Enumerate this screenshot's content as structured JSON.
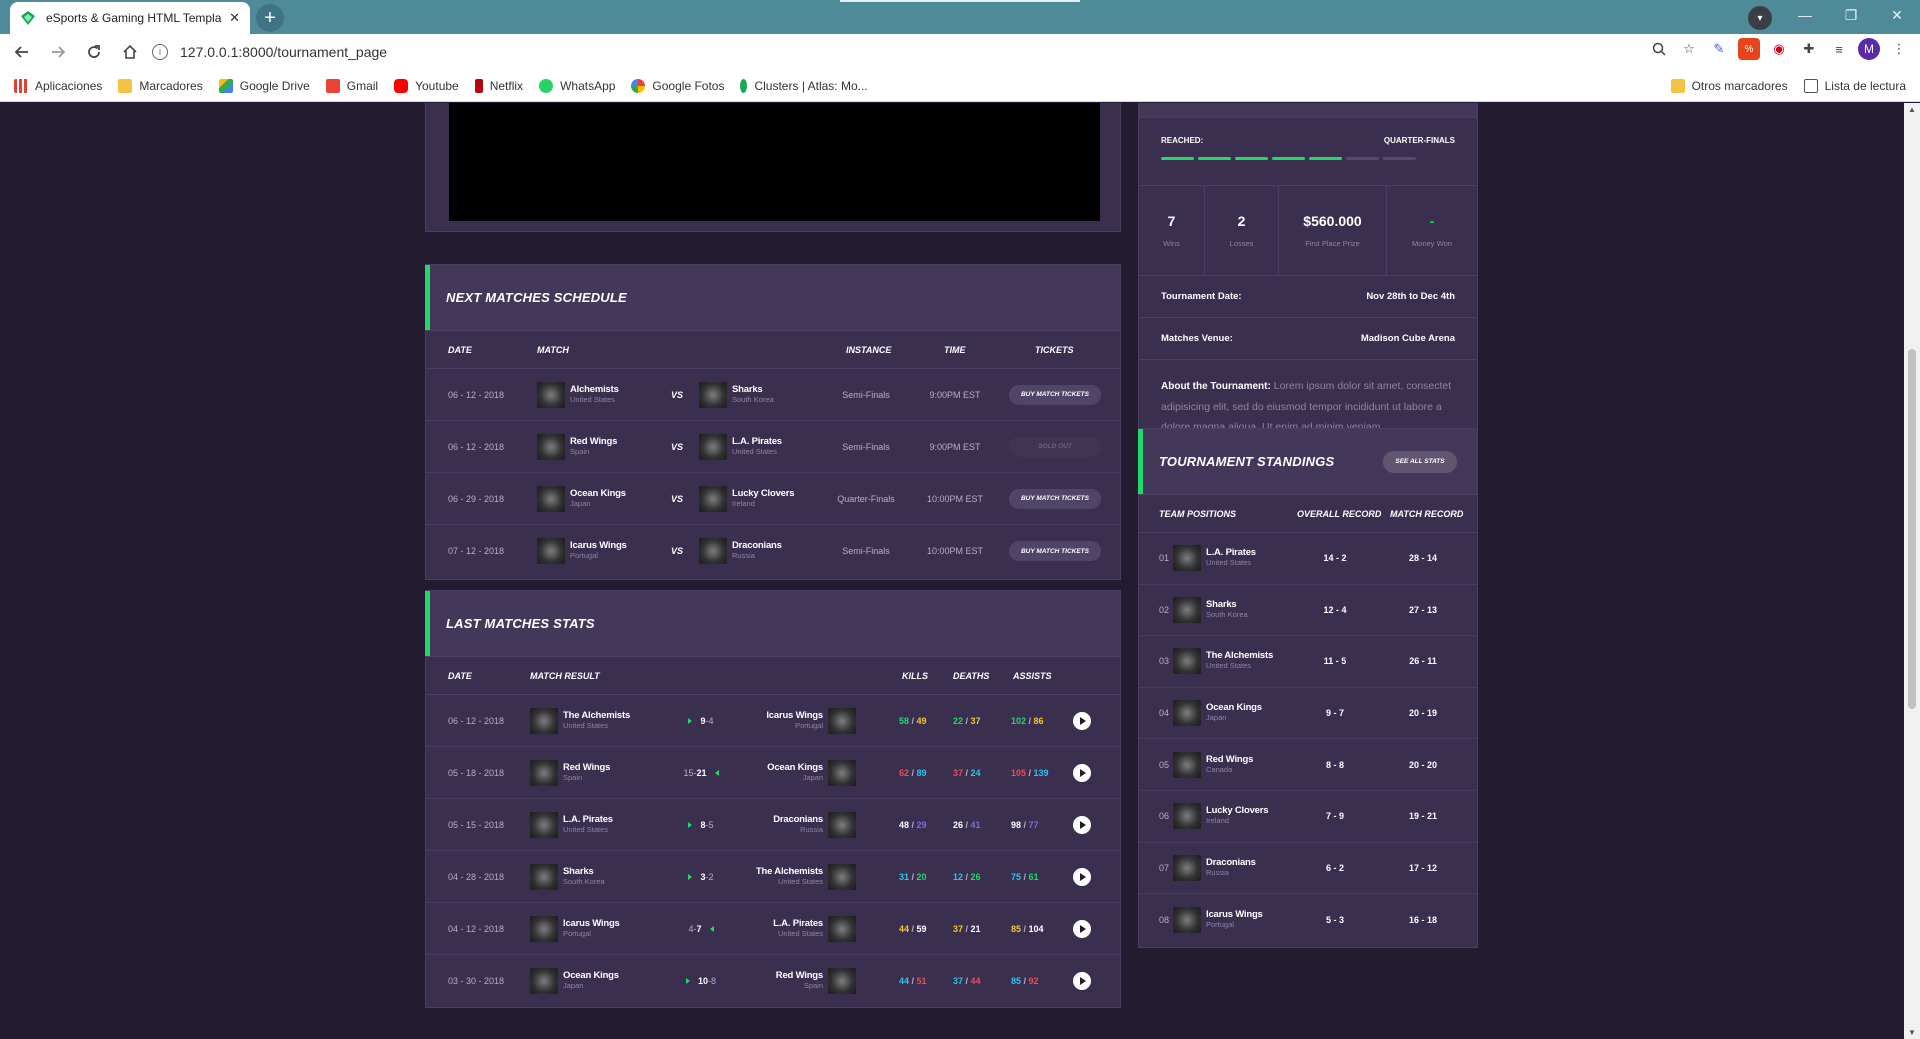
{
  "browser": {
    "tab_title": "eSports & Gaming HTML Templa",
    "url": "127.0.0.1:8000/tournament_page",
    "bookmarks": [
      "Aplicaciones",
      "Marcadores",
      "Google Drive",
      "Gmail",
      "Youtube",
      "Netflix",
      "WhatsApp",
      "Google Fotos",
      "Clusters | Atlas: Mo..."
    ],
    "bookmarks_right": [
      "Otros marcadores",
      "Lista de lectura"
    ],
    "profile_initial": "M"
  },
  "schedule": {
    "title": "NEXT MATCHES SCHEDULE",
    "headers": {
      "date": "DATE",
      "match": "MATCH",
      "instance": "INSTANCE",
      "time": "TIME",
      "tickets": "TICKETS"
    },
    "vs": "VS",
    "rows": [
      {
        "date": "06 - 12 - 2018",
        "t1": "Alchemists",
        "c1": "United States",
        "t2": "Sharks",
        "c2": "South Korea",
        "instance": "Semi-Finals",
        "time": "9:00PM EST",
        "ticket": "BUY MATCH TICKETS",
        "sold": false
      },
      {
        "date": "06 - 12 - 2018",
        "t1": "Red Wings",
        "c1": "Spain",
        "t2": "L.A. Pirates",
        "c2": "United States",
        "instance": "Semi-Finals",
        "time": "9:00PM EST",
        "ticket": "SOLD OUT",
        "sold": true
      },
      {
        "date": "06 - 29 - 2018",
        "t1": "Ocean Kings",
        "c1": "Japan",
        "t2": "Lucky Clovers",
        "c2": "Ireland",
        "instance": "Quarter-Finals",
        "time": "10:00PM EST",
        "ticket": "BUY MATCH TICKETS",
        "sold": false
      },
      {
        "date": "07 - 12 - 2018",
        "t1": "Icarus Wings",
        "c1": "Portugal",
        "t2": "Draconians",
        "c2": "Russia",
        "instance": "Semi-Finals",
        "time": "10:00PM EST",
        "ticket": "BUY MATCH TICKETS",
        "sold": false
      }
    ]
  },
  "stats": {
    "title": "LAST MATCHES STATS",
    "headers": {
      "date": "DATE",
      "result": "MATCH RESULT",
      "kills": "KILLS",
      "deaths": "DEATHS",
      "assists": "ASSISTS"
    },
    "rows": [
      {
        "date": "06 - 12 - 2018",
        "t1": "The Alchemists",
        "c1": "United States",
        "s1": "9",
        "s2": "4",
        "winner": "left",
        "t2": "Icarus Wings",
        "c2": "Portugal",
        "k1": "58",
        "k2": "49",
        "d1": "22",
        "d2": "37",
        "a1": "102",
        "a2": "86",
        "c_k1": "green",
        "c_k2": "yellow",
        "c_d1": "green",
        "c_d2": "yellow",
        "c_a1": "green",
        "c_a2": "yellow"
      },
      {
        "date": "05 - 18 - 2018",
        "t1": "Red Wings",
        "c1": "Spain",
        "s1": "15",
        "s2": "21",
        "winner": "right",
        "t2": "Ocean Kings",
        "c2": "Japan",
        "k1": "62",
        "k2": "89",
        "d1": "37",
        "d2": "24",
        "a1": "105",
        "a2": "139",
        "c_k1": "red",
        "c_k2": "blue",
        "c_d1": "red",
        "c_d2": "blue",
        "c_a1": "red",
        "c_a2": "blue"
      },
      {
        "date": "05 - 15 - 2018",
        "t1": "L.A. Pirates",
        "c1": "United States",
        "s1": "8",
        "s2": "5",
        "winner": "left",
        "t2": "Draconians",
        "c2": "Russia",
        "k1": "48",
        "k2": "29",
        "d1": "26",
        "d2": "41",
        "a1": "98",
        "a2": "77",
        "c_k1": "white",
        "c_k2": "purple",
        "c_d1": "white",
        "c_d2": "purple",
        "c_a1": "white",
        "c_a2": "purple"
      },
      {
        "date": "04 - 28 - 2018",
        "t1": "Sharks",
        "c1": "South Korea",
        "s1": "3",
        "s2": "2",
        "winner": "left",
        "t2": "The Alchemists",
        "c2": "United States",
        "k1": "31",
        "k2": "20",
        "d1": "12",
        "d2": "26",
        "a1": "75",
        "a2": "61",
        "c_k1": "blue",
        "c_k2": "green",
        "c_d1": "blue",
        "c_d2": "green",
        "c_a1": "blue",
        "c_a2": "green"
      },
      {
        "date": "04 - 12 - 2018",
        "t1": "Icarus Wings",
        "c1": "Portugal",
        "s1": "4",
        "s2": "7",
        "winner": "right",
        "t2": "L.A. Pirates",
        "c2": "United States",
        "k1": "44",
        "k2": "59",
        "d1": "37",
        "d2": "21",
        "a1": "85",
        "a2": "104",
        "c_k1": "yellow",
        "c_k2": "white",
        "c_d1": "yellow",
        "c_d2": "white",
        "c_a1": "yellow",
        "c_a2": "white"
      },
      {
        "date": "03 - 30 - 2018",
        "t1": "Ocean Kings",
        "c1": "Japan",
        "s1": "10",
        "s2": "8",
        "winner": "left",
        "t2": "Red Wings",
        "c2": "Spain",
        "k1": "44",
        "k2": "51",
        "d1": "37",
        "d2": "44",
        "a1": "85",
        "a2": "92",
        "c_k1": "blue",
        "c_k2": "red",
        "c_d1": "blue",
        "c_d2": "red",
        "c_a1": "blue",
        "c_a2": "red"
      }
    ]
  },
  "tournament": {
    "reached_label": "REACHED:",
    "reached_value": "QUARTER-FINALS",
    "progress_segments_filled": 5,
    "progress_segments_total": 7,
    "wins": "7",
    "wins_label": "Wins",
    "losses": "2",
    "losses_label": "Losses",
    "prize": "$560.000",
    "prize_label": "First Place Prize",
    "money": "-",
    "money_label": "Money Won",
    "date_label": "Tournament Date:",
    "date_value": "Nov 28th to Dec 4th",
    "venue_label": "Matches Venue:",
    "venue_value": "Madison Cube Arena",
    "about_label": "About the Tournament:",
    "about_text": "Lorem ipsum dolor sit amet, consectet adipisicing elit, sed do eiusmod tempor incididunt ut labore a dolore magna aliqua. Ut enim ad minim veniam."
  },
  "standings": {
    "title": "TOURNAMENT STANDINGS",
    "button": "SEE ALL STATS",
    "headers": {
      "pos": "TEAM POSITIONS",
      "overall": "OVERALL RECORD",
      "match": "MATCH RECORD"
    },
    "rows": [
      {
        "pos": "01",
        "team": "L.A. Pirates",
        "country": "United States",
        "overall": "14 - 2",
        "match": "28 - 14"
      },
      {
        "pos": "02",
        "team": "Sharks",
        "country": "South Korea",
        "overall": "12 - 4",
        "match": "27 - 13"
      },
      {
        "pos": "03",
        "team": "The Alchemists",
        "country": "United States",
        "overall": "11 - 5",
        "match": "26 - 11"
      },
      {
        "pos": "04",
        "team": "Ocean Kings",
        "country": "Japan",
        "overall": "9 - 7",
        "match": "20 - 19"
      },
      {
        "pos": "05",
        "team": "Red Wings",
        "country": "Canada",
        "overall": "8 - 8",
        "match": "20 - 20"
      },
      {
        "pos": "06",
        "team": "Lucky Clovers",
        "country": "Ireland",
        "overall": "7 - 9",
        "match": "19 - 21"
      },
      {
        "pos": "07",
        "team": "Draconians",
        "country": "Russia",
        "overall": "6 - 2",
        "match": "17 - 12"
      },
      {
        "pos": "08",
        "team": "Icarus Wings",
        "country": "Portugal",
        "overall": "5 - 3",
        "match": "16 - 18"
      }
    ]
  }
}
